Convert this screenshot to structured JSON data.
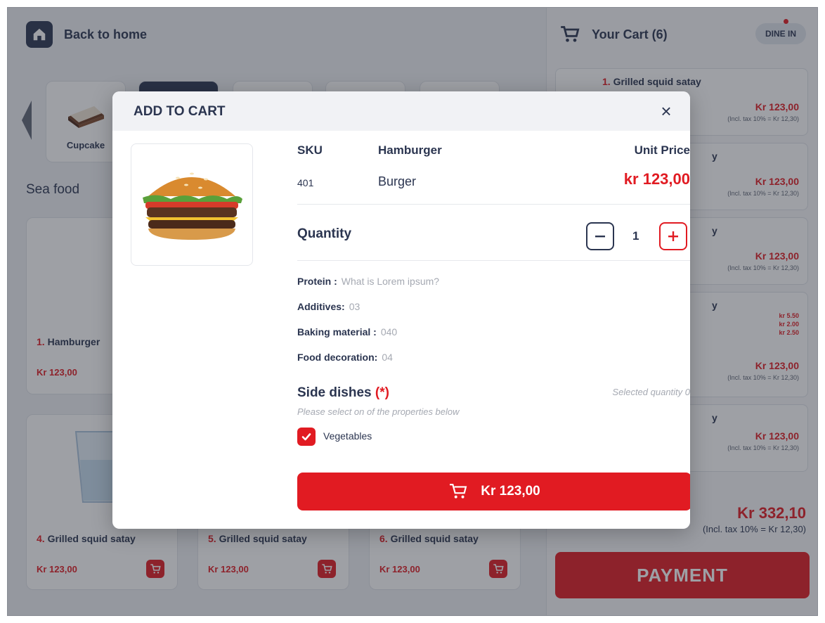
{
  "header": {
    "back_label": "Back to home"
  },
  "categories": [
    {
      "label": "Cupcake"
    },
    {
      "label": ""
    },
    {
      "label": ""
    },
    {
      "label": ""
    },
    {
      "label": ""
    }
  ],
  "section": {
    "title": "Sea food"
  },
  "products": [
    {
      "num": "1.",
      "name": "Hamburger",
      "price": "Kr 123,00"
    },
    {
      "num": "4.",
      "name": "Grilled squid satay",
      "price": "Kr 123,00"
    },
    {
      "num": "5.",
      "name": "Grilled squid satay",
      "price": "Kr 123,00"
    },
    {
      "num": "6.",
      "name": "Grilled squid satay",
      "price": "Kr 123,00"
    }
  ],
  "cart": {
    "title": "Your Cart (6)",
    "mode": "DINE IN",
    "items": [
      {
        "num": "1.",
        "name": "Grilled squid satay",
        "price": "Kr 123,00",
        "tax": "(Incl. tax 10% = Kr 12,30)"
      },
      {
        "name_tail": "y",
        "price": "Kr 123,00",
        "tax": "(Incl. tax 10% = Kr 12,30)"
      },
      {
        "name_tail": "y",
        "price": "Kr 123,00",
        "tax": "(Incl. tax 10% = Kr 12,30)"
      },
      {
        "name_tail": "y",
        "extras": [
          "kr 5.50",
          "kr 2.00",
          "kr 2.50"
        ],
        "price": "Kr 123,00",
        "tax": "(Incl. tax 10% = Kr 12,30)"
      },
      {
        "name_tail": "y",
        "price": "Kr 123,00",
        "tax": "(Incl. tax 10% = Kr 12,30)"
      }
    ],
    "total": "Kr 332,10",
    "total_tax": "(Incl. tax 10% = Kr 12,30)",
    "payment_label": "PAYMENT"
  },
  "modal": {
    "title": "ADD TO CART",
    "sku_label": "SKU",
    "sku_value": "401",
    "name_label": "Hamburger",
    "name_value": "Burger",
    "unit_price_label": "Unit Price",
    "unit_price_value": "kr 123,00",
    "quantity_label": "Quantity",
    "quantity_value": "1",
    "attributes": [
      {
        "label": "Protein :",
        "value": "What is Lorem ipsum?"
      },
      {
        "label": "Additives:",
        "value": "03"
      },
      {
        "label": "Baking material :",
        "value": "040"
      },
      {
        "label": "Food decoration:",
        "value": "04"
      }
    ],
    "side_dishes_label": "Side dishes",
    "side_dishes_required": "(*)",
    "side_dishes_hint": "Please select on of the properties below",
    "selected_quantity": "Selected quantity 0",
    "option_label": "Vegetables",
    "option_checked": true,
    "add_button_label": "Kr 123,00"
  },
  "colors": {
    "accent": "#e11b22",
    "navy": "#2b3550"
  },
  "icons": [
    "home-icon",
    "cart-icon",
    "close-icon",
    "minus-icon",
    "plus-icon",
    "check-icon",
    "chevron-left-icon"
  ]
}
